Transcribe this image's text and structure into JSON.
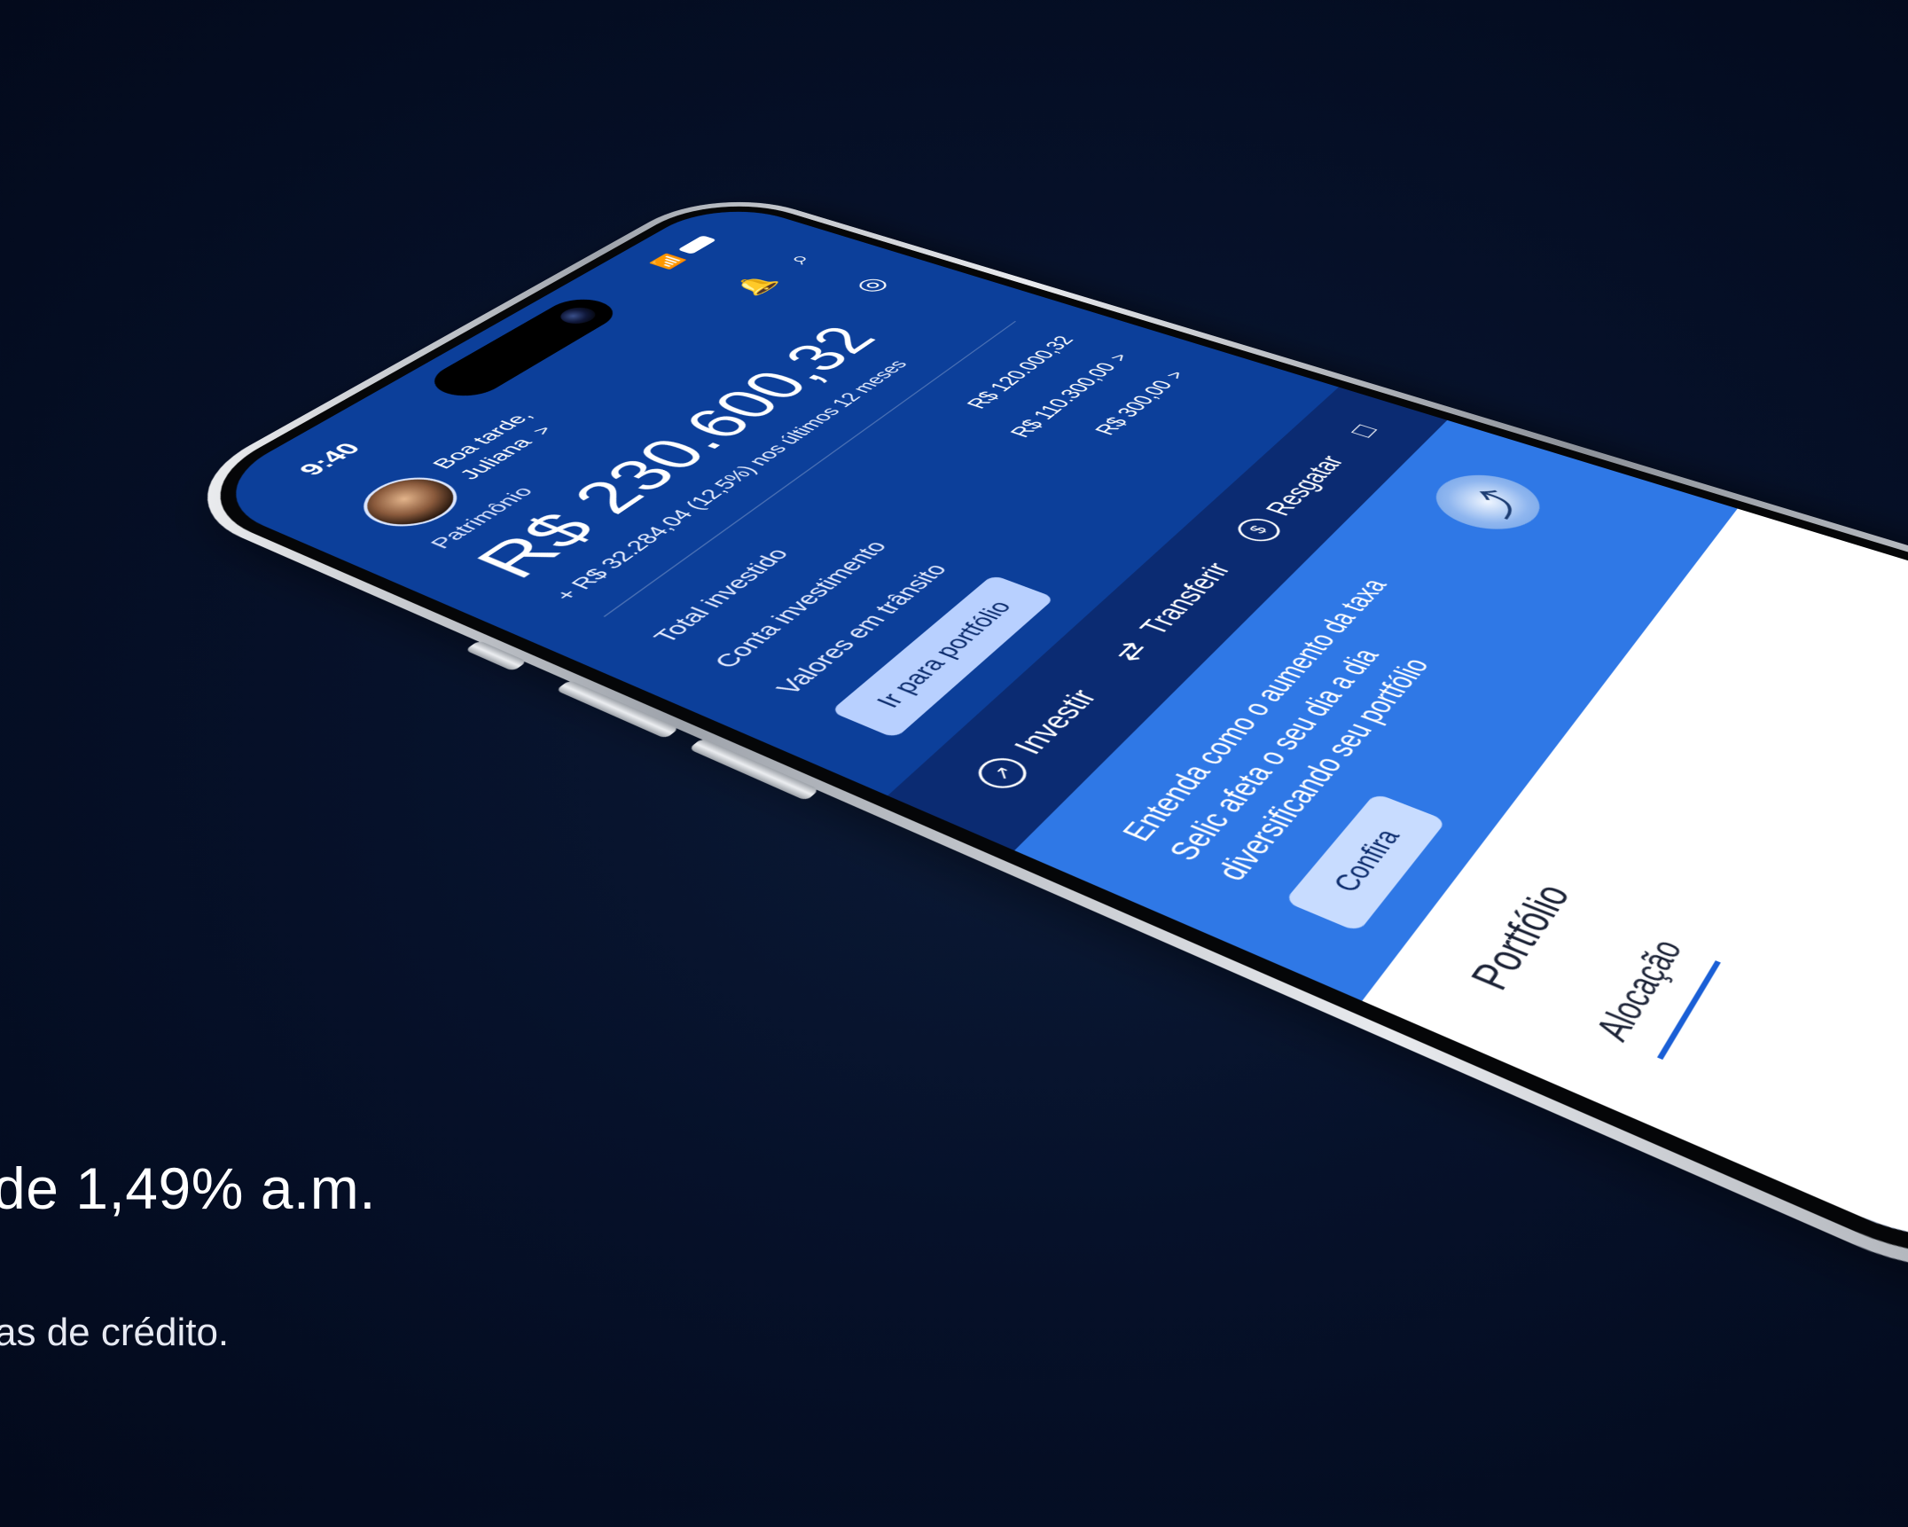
{
  "promo": {
    "title_fragment": "de 1,49% a.m.",
    "subtitle_fragment": "as de crédito."
  },
  "status_bar": {
    "time": "9:40",
    "icons": [
      "wifi-icon",
      "battery-icon"
    ]
  },
  "header": {
    "greeting_line1": "Boa tarde,",
    "greeting_line2": "Juliana",
    "greeting_chevron": ">",
    "icons": [
      "bell-icon",
      "search-icon"
    ]
  },
  "summary": {
    "label": "Patrimônio",
    "balance": "R$ 230.600,32",
    "gain": "+ R$ 32.284,04 (12,5%) nos últimos 12 meses",
    "visibility_icon": "eye-slash-icon"
  },
  "rows": [
    {
      "label": "Total investido",
      "value": "R$ 120.000,32",
      "chevron": ""
    },
    {
      "label": "Conta investimento",
      "value": "R$ 110.300,00",
      "chevron": ">"
    },
    {
      "label": "Valores em trânsito",
      "value": "R$ 300,00",
      "chevron": ">"
    }
  ],
  "portfolio_button": "Ir para portfólio",
  "actions": [
    {
      "label": "Investir",
      "icon": "trend-up-icon"
    },
    {
      "label": "Transferir",
      "icon": "transfer-arrows-icon"
    },
    {
      "label": "Resgatar",
      "icon": "money-out-icon"
    }
  ],
  "extra_action_icon": "document-icon",
  "banner": {
    "text": "Entenda como o aumento da taxa Selic afeta o seu dia a dia diversificando seu portfólio",
    "button": "Confira",
    "image_icon": "growth-illustration-icon"
  },
  "portfolio": {
    "title": "Portfólio",
    "tabs": [
      "Alocação"
    ]
  },
  "colors": {
    "background": "#040d22",
    "screen_blue": "#0c3f9a",
    "action_bar": "#0b2b72",
    "banner_blue": "#2f78e6",
    "button_light": "#b8d0ff"
  }
}
